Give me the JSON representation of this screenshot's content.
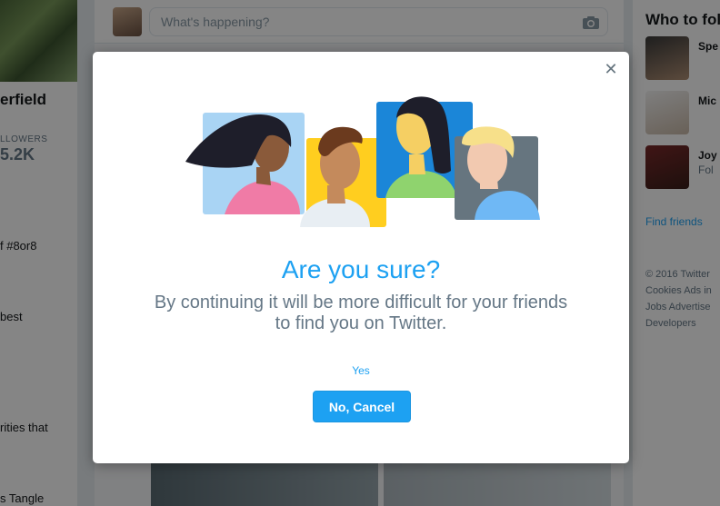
{
  "profile": {
    "name_fragment": "erfield",
    "followers_label": "LLOWERS",
    "followers_count": "5.2K",
    "text_fragments": [
      "f #8or8",
      "best",
      "rities that",
      "s Tangle"
    ]
  },
  "compose": {
    "placeholder": "What's happening?"
  },
  "who_to_follow": {
    "title": "Who to fol",
    "users": [
      {
        "name": "Spe",
        "sub": ""
      },
      {
        "name": "Mic",
        "sub": ""
      },
      {
        "name": "Joy",
        "sub": "Fol"
      }
    ],
    "find_friends": "Find friends",
    "footer": [
      "© 2016 Twitter",
      "Cookies  Ads in",
      "Jobs  Advertise",
      "Developers"
    ]
  },
  "modal": {
    "close_icon": "close-icon",
    "title": "Are you sure?",
    "body": "By continuing it will be more difficult for your friends to find you on Twitter.",
    "yes_label": "Yes",
    "cancel_label": "No, Cancel",
    "colors": {
      "accent": "#1da1f2",
      "body_text": "#657786"
    }
  }
}
